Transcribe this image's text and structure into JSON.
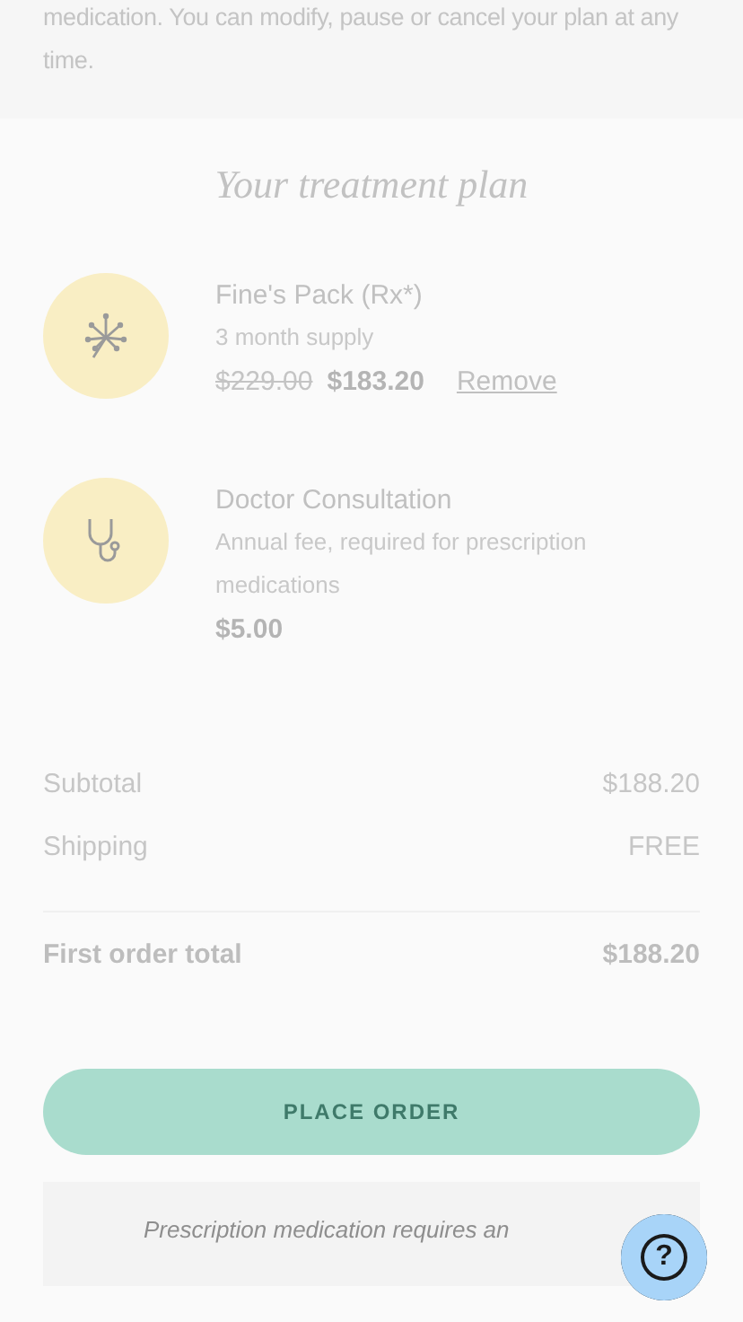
{
  "intro": {
    "text": "medication. You can modify, pause or cancel your plan at any time."
  },
  "plan": {
    "title": "Your treatment plan",
    "items": [
      {
        "kind": "flower",
        "name": "Fine's Pack (Rx*)",
        "details": "3 month supply",
        "old_price": "$229.00",
        "price": "$183.20",
        "remove": "Remove"
      },
      {
        "kind": "stethoscope",
        "name": "Doctor Consultation",
        "details": "Annual fee, required for prescription medications",
        "price": "$5.00"
      }
    ]
  },
  "summary": {
    "rows": [
      {
        "label": "Subtotal",
        "value": "$188.20"
      },
      {
        "label": "Shipping",
        "value": "FREE"
      }
    ],
    "total": {
      "label": "First order total",
      "value": "$188.20"
    }
  },
  "place_order": {
    "label": "PLACE ORDER",
    "disabled": true
  },
  "note": {
    "text": "Prescription medication requires an"
  },
  "help": {
    "label": "?"
  }
}
